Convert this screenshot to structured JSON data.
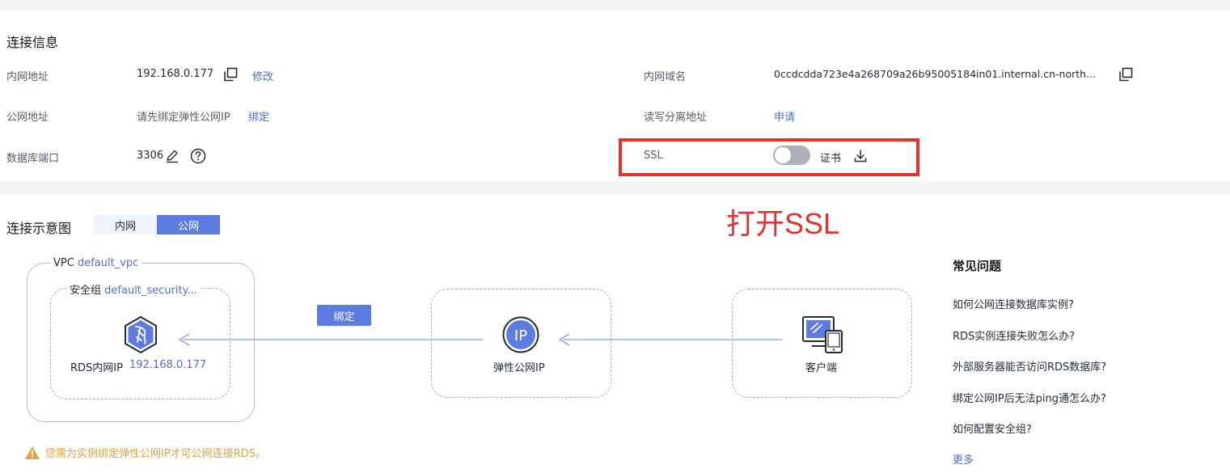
{
  "connection_info": {
    "title": "连接信息",
    "private_ip": {
      "label": "内网地址",
      "value": "192.168.0.177",
      "edit_link": "修改"
    },
    "public_ip": {
      "label": "公网地址",
      "value": "请先绑定弹性公网IP",
      "bind_link": "绑定"
    },
    "db_port": {
      "label": "数据库端口",
      "value": "3306"
    },
    "private_domain": {
      "label": "内网域名",
      "value": "0ccdcdda723e4a268709a26b95005184in01.internal.cn-north..."
    },
    "rw_split": {
      "label": "读写分离地址",
      "apply_link": "申请"
    },
    "ssl": {
      "label": "SSL",
      "enabled": false,
      "cert_label": "证书"
    }
  },
  "annotation": {
    "text": "打开SSL",
    "color": "#e5322d"
  },
  "diagram": {
    "title": "连接示意图",
    "tabs": [
      {
        "label": "内网",
        "active": false
      },
      {
        "label": "公网",
        "active": true
      }
    ],
    "vpc": {
      "label": "VPC",
      "name": "default_vpc"
    },
    "security_group": {
      "label": "安全组",
      "name": "default_security..."
    },
    "rds": {
      "label": "RDS内网IP",
      "ip": "192.168.0.177"
    },
    "bind_button": "绑定",
    "eip": {
      "label": "弹性公网IP",
      "icon_text": "IP"
    },
    "client": {
      "label": "客户端"
    },
    "warning": "您需为实例绑定弹性公网IP才可公网连接RDS。"
  },
  "faq": {
    "title": "常见问题",
    "items": [
      "如何公网连接数据库实例?",
      "RDS实例连接失败怎么办?",
      "外部服务器能否访问RDS数据库?",
      "绑定公网IP后无法ping通怎么办?",
      "如何配置安全组?"
    ],
    "more": "更多"
  },
  "colors": {
    "accent": "#5e7ce0",
    "link": "#526ecc",
    "warning": "#e6a23c",
    "highlight": "#e5322d"
  }
}
